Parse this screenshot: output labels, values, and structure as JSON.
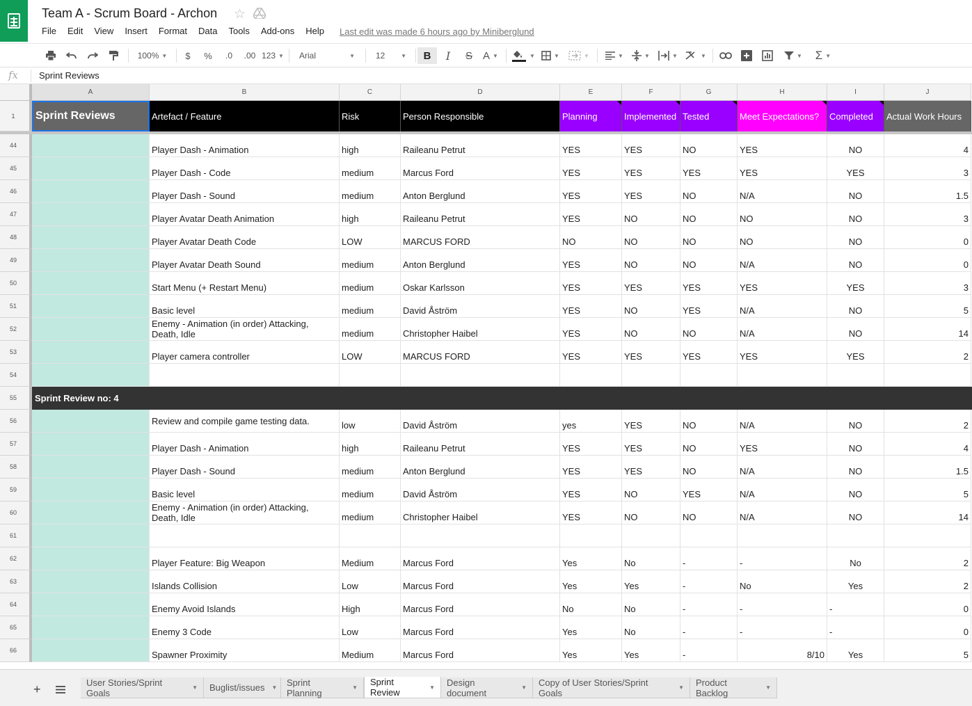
{
  "header": {
    "title": "Team A - Scrum Board - Archon",
    "menus": [
      "File",
      "Edit",
      "View",
      "Insert",
      "Format",
      "Data",
      "Tools",
      "Add-ons",
      "Help"
    ],
    "last_edit": "Last edit was made 6 hours ago by Miniberglund"
  },
  "toolbar": {
    "zoom": "100%",
    "currency": "$",
    "percent": "%",
    "decimal_dec": ".0",
    "decimal_inc": ".00",
    "more_formats": "123",
    "font": "Arial",
    "font_size": "12",
    "bold": "B",
    "italic": "I",
    "strike": "S",
    "text_color": "A"
  },
  "formula_bar": {
    "fx": "fx",
    "value": "Sprint Reviews"
  },
  "columns": [
    "A",
    "B",
    "C",
    "D",
    "E",
    "F",
    "G",
    "H",
    "I",
    "J"
  ],
  "header_row": {
    "row_num": "1",
    "cells": [
      "Sprint Reviews",
      "Artefact / Feature",
      "Risk",
      "Person Responsible",
      "Planning",
      "Implemented",
      "Tested",
      "Meet Expectations?",
      "Completed",
      "Actual Work Hours"
    ]
  },
  "colors": {
    "header_black": "#000000",
    "header_purple": "#9900ff",
    "header_magenta": "#ff00ff",
    "header_gray": "#666666",
    "sprint_teal": "#c2e9e0",
    "section_dark": "#333333"
  },
  "rows": [
    {
      "n": "44",
      "cells": [
        "",
        "Player Dash - Animation",
        "high",
        "Raileanu Petrut",
        "YES",
        "YES",
        "NO",
        "YES",
        "NO",
        "4"
      ]
    },
    {
      "n": "45",
      "cells": [
        "",
        "Player Dash - Code",
        "medium",
        "Marcus Ford",
        "YES",
        "YES",
        "YES",
        "YES",
        "YES",
        "3"
      ]
    },
    {
      "n": "46",
      "cells": [
        "",
        "Player Dash - Sound",
        "medium",
        "Anton Berglund",
        "YES",
        "YES",
        "NO",
        "N/A",
        "NO",
        "1.5"
      ]
    },
    {
      "n": "47",
      "cells": [
        "",
        "Player Avatar Death Animation",
        "high",
        "Raileanu Petrut",
        "YES",
        "NO",
        "NO",
        "NO",
        "NO",
        "3"
      ]
    },
    {
      "n": "48",
      "cells": [
        "",
        "Player Avatar Death Code",
        "LOW",
        "MARCUS FORD",
        "NO",
        "NO",
        "NO",
        "NO",
        "NO",
        "0"
      ]
    },
    {
      "n": "49",
      "cells": [
        "",
        "Player Avatar Death Sound",
        "medium",
        "Anton Berglund",
        "YES",
        "NO",
        "NO",
        "N/A",
        "NO",
        "0"
      ]
    },
    {
      "n": "50",
      "cells": [
        "",
        "Start Menu (+ Restart Menu)",
        "medium",
        "Oskar Karlsson",
        "YES",
        "YES",
        "YES",
        "YES",
        "YES",
        "3"
      ]
    },
    {
      "n": "51",
      "cells": [
        "",
        "Basic level",
        "medium",
        "David Åström",
        "YES",
        "NO",
        "YES",
        "N/A",
        "NO",
        "5"
      ]
    },
    {
      "n": "52",
      "cells": [
        "",
        "Enemy - Animation (in order) Attacking, Death, Idle",
        "medium",
        "Christopher Haibel",
        "YES",
        "NO",
        "NO",
        "N/A",
        "NO",
        "14"
      ]
    },
    {
      "n": "53",
      "cells": [
        "",
        "Player camera controller",
        "LOW",
        "MARCUS FORD",
        "YES",
        "YES",
        "YES",
        "YES",
        "YES",
        "2"
      ]
    },
    {
      "n": "54",
      "cells": [
        "",
        "",
        "",
        "",
        "",
        "",
        "",
        "",
        "",
        ""
      ]
    },
    {
      "n": "55",
      "section": "Sprint Review no: 4"
    },
    {
      "n": "56",
      "cells": [
        "",
        "Review and compile game testing data.",
        "low",
        "David Åström",
        "yes",
        "YES",
        "NO",
        "N/A",
        "NO",
        "2"
      ]
    },
    {
      "n": "57",
      "cells": [
        "",
        "Player Dash - Animation",
        "high",
        "Raileanu Petrut",
        "YES",
        "YES",
        "NO",
        "YES",
        "NO",
        "4"
      ]
    },
    {
      "n": "58",
      "cells": [
        "",
        "Player Dash - Sound",
        "medium",
        "Anton Berglund",
        "YES",
        "YES",
        "NO",
        "N/A",
        "NO",
        "1.5"
      ]
    },
    {
      "n": "59",
      "cells": [
        "",
        "Basic level",
        "medium",
        "David Åström",
        "YES",
        "NO",
        "YES",
        "N/A",
        "NO",
        "5"
      ]
    },
    {
      "n": "60",
      "cells": [
        "",
        "Enemy - Animation (in order) Attacking, Death, Idle",
        "medium",
        "Christopher Haibel",
        "YES",
        "NO",
        "NO",
        "N/A",
        "NO",
        "14"
      ]
    },
    {
      "n": "61",
      "cells": [
        "",
        "",
        "",
        "",
        "",
        "",
        "",
        "",
        "",
        ""
      ]
    },
    {
      "n": "62",
      "cells": [
        "",
        "Player Feature: Big Weapon",
        "Medium",
        "Marcus Ford",
        "Yes",
        "No",
        "-",
        "-",
        "No",
        "2"
      ]
    },
    {
      "n": "63",
      "cells": [
        "",
        "Islands Collision",
        "Low",
        "Marcus Ford",
        "Yes",
        "Yes",
        "-",
        "No",
        "Yes",
        "2"
      ]
    },
    {
      "n": "64",
      "cells": [
        "",
        "Enemy Avoid Islands",
        "High",
        "Marcus Ford",
        "No",
        "No",
        "-",
        "-",
        "-",
        "0"
      ]
    },
    {
      "n": "65",
      "cells": [
        "",
        "Enemy 3 Code",
        "Low",
        "Marcus Ford",
        "Yes",
        "No",
        "-",
        "-",
        "-",
        "0"
      ]
    },
    {
      "n": "66",
      "cells": [
        "",
        "Spawner Proximity",
        "Medium",
        "Marcus Ford",
        "Yes",
        "Yes",
        "-",
        "8/10",
        "Yes",
        "5"
      ]
    }
  ],
  "tabs": [
    {
      "label": "User Stories/Sprint Goals"
    },
    {
      "label": "Buglist/issues"
    },
    {
      "label": "Sprint Planning"
    },
    {
      "label": "Sprint Review",
      "active": true
    },
    {
      "label": "Design document"
    },
    {
      "label": "Copy of User Stories/Sprint Goals"
    },
    {
      "label": "Product Backlog"
    }
  ]
}
